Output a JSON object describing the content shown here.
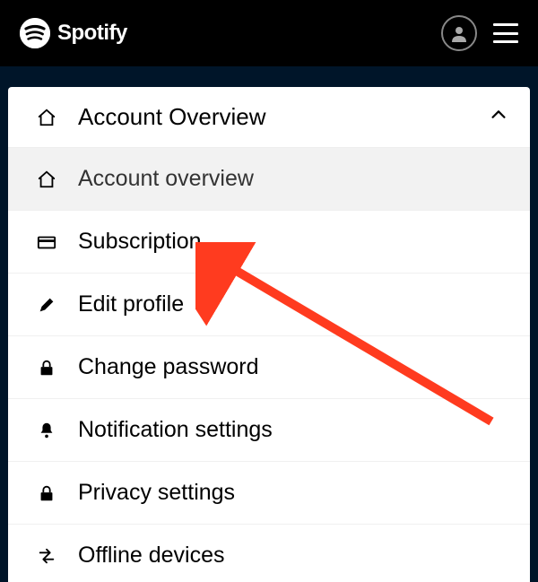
{
  "header": {
    "brand": "Spotify"
  },
  "panel": {
    "header_label": "Account Overview",
    "items": [
      {
        "label": "Account overview",
        "icon": "home",
        "active": true
      },
      {
        "label": "Subscription",
        "icon": "card",
        "active": false
      },
      {
        "label": "Edit profile",
        "icon": "pen",
        "active": false
      },
      {
        "label": "Change password",
        "icon": "lock",
        "active": false
      },
      {
        "label": "Notification settings",
        "icon": "bell",
        "active": false
      },
      {
        "label": "Privacy settings",
        "icon": "lock",
        "active": false
      },
      {
        "label": "Offline devices",
        "icon": "swap",
        "active": false
      }
    ]
  }
}
